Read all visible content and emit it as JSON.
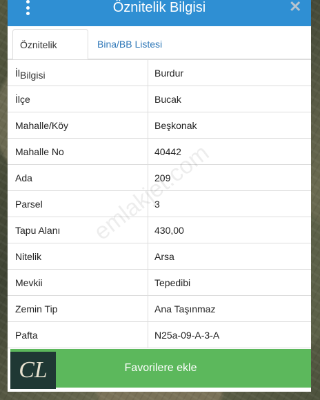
{
  "header": {
    "title": "Öznitelik Bilgisi",
    "menu_icon": "kebab-menu-icon",
    "close_icon": "close-icon"
  },
  "tabs": [
    {
      "label": "Öznitelik Bilgisi",
      "active": true
    },
    {
      "label": "Bina/BB Listesi",
      "active": false
    }
  ],
  "attributes": [
    {
      "key": "İl",
      "value": "Burdur"
    },
    {
      "key": "İlçe",
      "value": "Bucak"
    },
    {
      "key": "Mahalle/Köy",
      "value": "Beşkonak"
    },
    {
      "key": "Mahalle No",
      "value": "40442"
    },
    {
      "key": "Ada",
      "value": "209"
    },
    {
      "key": "Parsel",
      "value": "3"
    },
    {
      "key": "Tapu Alanı",
      "value": "430,00"
    },
    {
      "key": "Nitelik",
      "value": "Arsa"
    },
    {
      "key": "Mevkii",
      "value": "Tepedibi"
    },
    {
      "key": "Zemin Tip",
      "value": "Ana Taşınmaz"
    },
    {
      "key": "Pafta",
      "value": "N25a-09-A-3-A"
    }
  ],
  "footer": {
    "favorite_label": "Favorilere ekle",
    "logo_text": "CL"
  },
  "watermark": "emlakjet.com",
  "colors": {
    "titlebar": "#2f8fd3",
    "button": "#5cb85c",
    "tab_link": "#2f78b8"
  }
}
